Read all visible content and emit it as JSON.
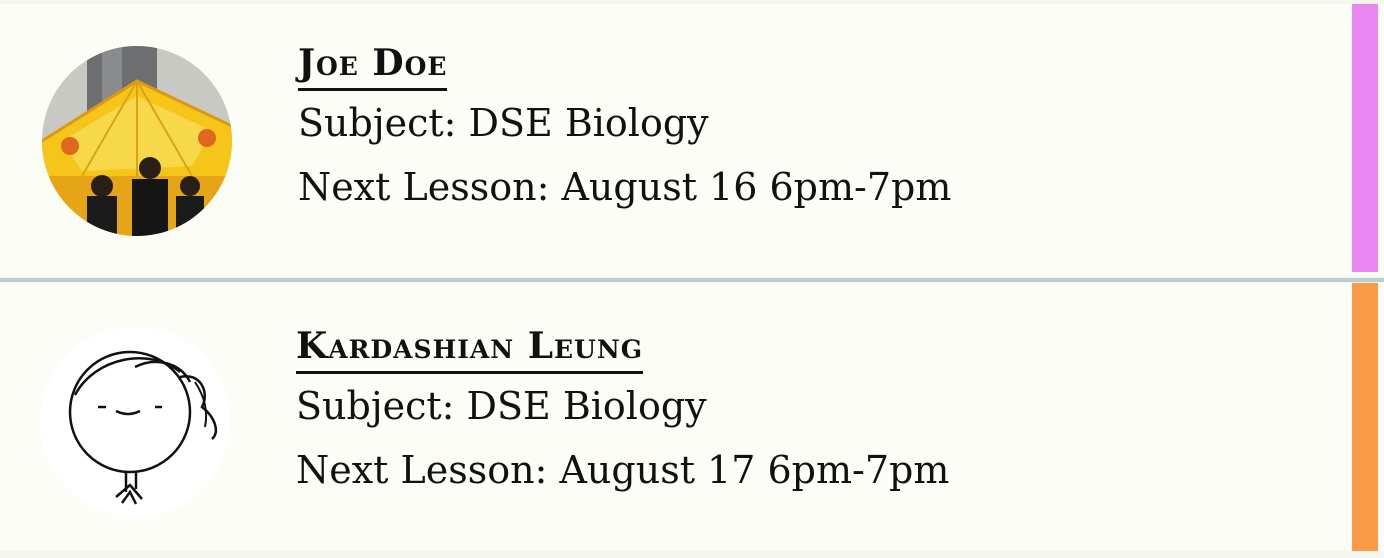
{
  "tutors": [
    {
      "name": "Joe Doe",
      "subject": "Subject: DSE Biology",
      "next_lesson": "Next Lesson: August 16 6pm-7pm",
      "accent_color": "#ea87f2",
      "avatar_icon": "photo-people-under-yellow-umbrella"
    },
    {
      "name": "Kardashian Leung",
      "subject": "Subject: DSE Biology",
      "next_lesson": "Next Lesson: August 17 6pm-7pm",
      "accent_color": "#fb9b47",
      "avatar_icon": "doodle-smiling-face"
    }
  ]
}
